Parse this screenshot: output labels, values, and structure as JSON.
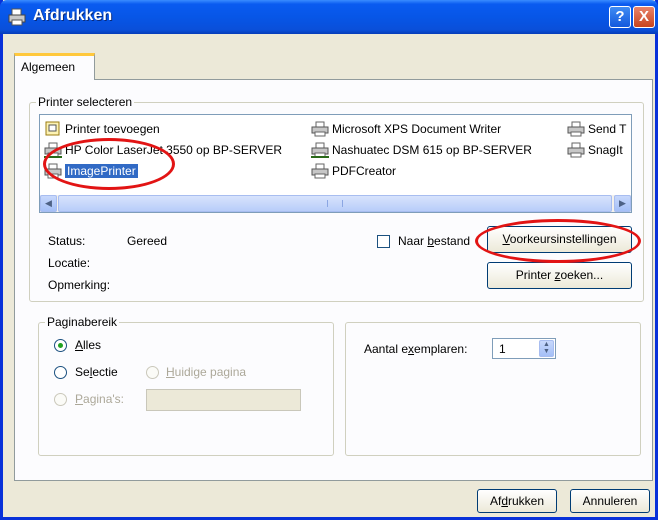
{
  "window": {
    "title": "Afdrukken",
    "help_glyph": "?",
    "close_glyph": "X"
  },
  "tabs": [
    {
      "label": "Algemeen"
    }
  ],
  "printer_group": {
    "legend": "Printer selecteren",
    "printers": [
      {
        "name": "Printer toevoegen",
        "icon": "add-printer-icon"
      },
      {
        "name": "Microsoft XPS Document Writer",
        "icon": "printer-icon"
      },
      {
        "name": "Send T",
        "icon": "printer-icon"
      },
      {
        "name": "HP Color LaserJet 3550 op BP-SERVER",
        "icon": "network-printer-icon"
      },
      {
        "name": "Nashuatec DSM 615 op BP-SERVER",
        "icon": "network-printer-icon"
      },
      {
        "name": "SnagIt",
        "icon": "printer-icon"
      },
      {
        "name": "ImagePrinter",
        "icon": "printer-icon",
        "selected": true
      },
      {
        "name": "PDFCreator",
        "icon": "printer-icon"
      }
    ],
    "scroll_left": "◀",
    "scroll_right": "▶"
  },
  "status": {
    "status_label": "Status:",
    "status_value": "Gereed",
    "location_label": "Locatie:",
    "location_value": "",
    "comment_label": "Opmerking:",
    "comment_value": ""
  },
  "print_to_file": {
    "label_pre": "Naar ",
    "label_u": "b",
    "label_post": "estand",
    "checked": false
  },
  "buttons": {
    "preferences": {
      "u": "V",
      "rest": "oorkeursinstellingen"
    },
    "find_printer": {
      "pre": "Printer ",
      "u": "z",
      "post": "oeken..."
    },
    "print": {
      "pre": "Af",
      "u": "d",
      "post": "rukken"
    },
    "cancel": {
      "label": "Annuleren"
    }
  },
  "page_range": {
    "legend": "Paginabereik",
    "all": {
      "u": "A",
      "rest": "lles",
      "selected": true
    },
    "selection": {
      "pre": "Se",
      "u": "l",
      "post": "ectie"
    },
    "current_page": {
      "u": "H",
      "rest": "uidige pagina"
    },
    "pages": {
      "u": "P",
      "rest": "agina's:",
      "value": ""
    }
  },
  "copies": {
    "label_pre": "Aantal e",
    "label_u": "x",
    "label_post": "emplaren:",
    "value": "1"
  },
  "colors": {
    "title_blue": "#0a5bf0",
    "selection_blue": "#316ac5",
    "annotation_red": "#e21414",
    "dialog_bg": "#ece9d8"
  }
}
